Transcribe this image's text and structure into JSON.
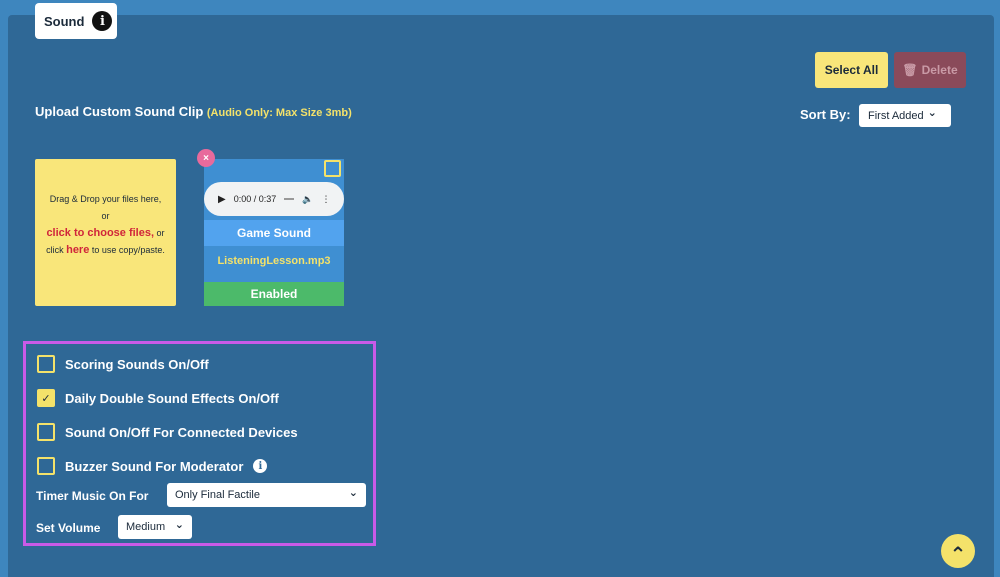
{
  "section": {
    "title": "Sound",
    "info_icon": "i"
  },
  "toolbar": {
    "select_all_label": "Select All",
    "delete_label": "Delete",
    "delete_icon": "🗑"
  },
  "upload": {
    "heading": "Upload Custom Sound Clip",
    "note": "(Audio Only: Max Size 3mb)"
  },
  "sort": {
    "label": "Sort By:",
    "selected": "First Added",
    "chevron": "⌄"
  },
  "dropzone": {
    "line1": "Drag & Drop your files here,",
    "line2": "or",
    "click_choose": "click to choose files,",
    "or_text": " or",
    "click_text": "click ",
    "here_link": "here",
    "tail": " to use copy/paste."
  },
  "sound_card": {
    "close_icon": "×",
    "audio_time": "0:00 / 0:37",
    "name": "Game Sound",
    "filename": "ListeningLesson.mp3",
    "status": "Enabled"
  },
  "settings": {
    "options": [
      {
        "label": "Scoring Sounds On/Off",
        "checked": false
      },
      {
        "label": "Daily Double Sound Effects On/Off",
        "checked": true
      },
      {
        "label": "Sound On/Off For Connected Devices",
        "checked": false
      },
      {
        "label": "Buzzer Sound For Moderator",
        "checked": false
      }
    ],
    "check_mark": "✓",
    "timer_label": "Timer Music On For",
    "timer_value": "Only Final Factile",
    "volume_label": "Set Volume",
    "volume_value": "Medium"
  },
  "scroll_top_icon": "⌃"
}
